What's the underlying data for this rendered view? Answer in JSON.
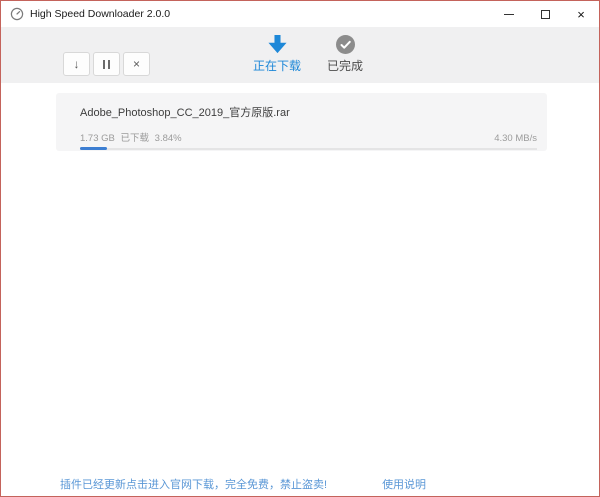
{
  "window": {
    "title": "High Speed Downloader 2.0.0",
    "close_glyph": "×"
  },
  "toolbar": {
    "resume_glyph": "↓",
    "cancel_glyph": "×",
    "tabs": [
      {
        "label": "正在下载",
        "active": true
      },
      {
        "label": "已完成",
        "active": false
      }
    ]
  },
  "downloads": [
    {
      "filename": "Adobe_Photoshop_CC_2019_官方原版.rar",
      "size": "1.73 GB",
      "downloaded_label": "已下载",
      "percent": "3.84%",
      "speed": "4.30 MB/s",
      "progress_style": "width:6%"
    }
  ],
  "footer": {
    "notice": "插件已经更新点击进入官网下载，完全免费，禁止盗卖!",
    "help_link": "使用说明"
  },
  "colors": {
    "accent_blue": "#1e88d8",
    "completed_gray": "#8c8c8c",
    "progress_fill": "#3c7ed2",
    "footer_link": "#5a97d6",
    "screenshot_border": "#c4635b"
  }
}
